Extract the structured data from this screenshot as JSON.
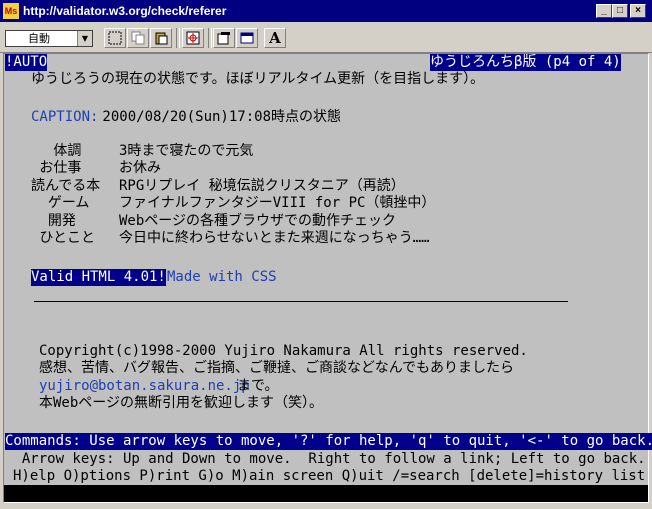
{
  "window": {
    "title": "http://validator.w3.org/check/referer",
    "icon_text": "Ms",
    "minimize": "_",
    "maximize": "□",
    "close": "×"
  },
  "toolbar": {
    "encoding": "自動",
    "font_button": "A"
  },
  "lynx": {
    "top_left": "!AUTO",
    "page_title": "ゆうじろんちβ版 (p4 of 4)",
    "intro": "ゆうじろうの現在の状態です。ほぼリアルタイム更新（を目指します）。",
    "caption_label": "CAPTION:",
    "caption_text": " 2000/08/20(Sun)17:08時点の状態",
    "status": [
      {
        "label": "　 体調 ",
        "value": "3時まで寝たので元気"
      },
      {
        "label": " お仕事  ",
        "value": "お休み"
      },
      {
        "label": "読んでる本",
        "value": "RPGリプレイ 秘境伝説クリスタニア（再読）"
      },
      {
        "label": "  ゲーム  ",
        "value": "ファイナルファンタジーVIII for PC（頓挫中）"
      },
      {
        "label": "  開発    ",
        "value": "Webページの各種ブラウザでの動作チェック"
      },
      {
        "label": " ひとこと ",
        "value": "今日中に終わらせないとまた来週になっちゃう……"
      }
    ],
    "valid_link": "Valid HTML 4.01!",
    "css_link": "Made with CSS",
    "copyright": "Copyright(c)1998-2000 Yujiro Nakamura All rights reserved.",
    "feedback": "感想、苦情、バグ報告、ご指摘、ご鞭撻、ご商談などなんでもありましたら",
    "email": "yujiro@botan.sakura.ne.jp",
    "email_suffix": "まで。",
    "quote": "本Webページの無断引用を歓迎します（笑）。",
    "commands": "Commands: Use arrow keys to move, '?' for help, 'q' to quit, '<-' to go back.",
    "arrow_help": "  Arrow keys: Up and Down to move.  Right to follow a link; Left to go back.",
    "key_help": "H)elp O)ptions P)rint G)o M)ain screen Q)uit /=search [delete]=history list"
  }
}
